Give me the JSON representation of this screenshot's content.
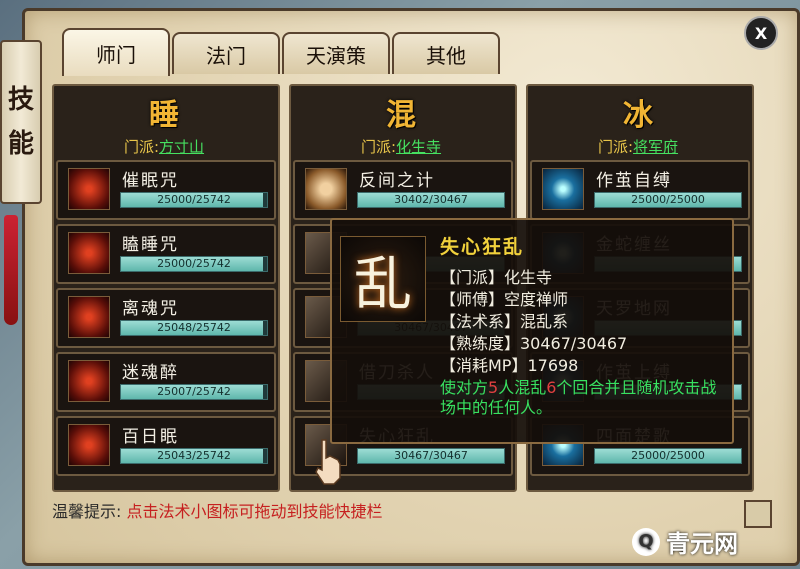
{
  "window": {
    "side_title": [
      "技",
      "能"
    ],
    "close_label": "X"
  },
  "tabs": [
    "师门",
    "法门",
    "天演策",
    "其他"
  ],
  "schools": [
    {
      "element": "睡",
      "sect_label": "门派:",
      "sect": "方寸山",
      "skills": [
        {
          "name": "催眠咒",
          "progress": "25000/25742",
          "fraction": 0.971,
          "icon": "red"
        },
        {
          "name": "瞌睡咒",
          "progress": "25000/25742",
          "fraction": 0.971,
          "icon": "red"
        },
        {
          "name": "离魂咒",
          "progress": "25048/25742",
          "fraction": 0.973,
          "icon": "red"
        },
        {
          "name": "迷魂醉",
          "progress": "25007/25742",
          "fraction": 0.971,
          "icon": "red"
        },
        {
          "name": "百日眠",
          "progress": "25043/25742",
          "fraction": 0.973,
          "icon": "red"
        }
      ]
    },
    {
      "element": "混",
      "sect_label": "门派:",
      "sect": "化生寺",
      "skills": [
        {
          "name": "反间之计",
          "progress": "30402/30467",
          "fraction": 0.998,
          "icon": "face"
        },
        {
          "name": "",
          "progress": "",
          "fraction": 0.998,
          "icon": "dark"
        },
        {
          "name": "",
          "progress": "30467/30467",
          "fraction": 1.0,
          "icon": "dark"
        },
        {
          "name": "借刀杀人",
          "progress": "",
          "fraction": 1.0,
          "icon": "dark"
        },
        {
          "name": "失心狂乱",
          "progress": "30467/30467",
          "fraction": 1.0,
          "icon": "dark"
        }
      ]
    },
    {
      "element": "冰",
      "sect_label": "门派:",
      "sect": "将军府",
      "skills": [
        {
          "name": "作茧自缚",
          "progress": "25000/25000",
          "fraction": 1.0,
          "icon": "blue"
        },
        {
          "name": "金蛇缠丝",
          "progress": "",
          "fraction": 1.0,
          "icon": "blue"
        },
        {
          "name": "天罗地网",
          "progress": "",
          "fraction": 1.0,
          "icon": "blue"
        },
        {
          "name": "作茧上缚",
          "progress": "",
          "fraction": 1.0,
          "icon": "blue"
        },
        {
          "name": "四面楚歌",
          "progress": "25000/25000",
          "fraction": 1.0,
          "icon": "blue"
        }
      ]
    }
  ],
  "tooltip": {
    "glyph": "乱",
    "title": "失心狂乱",
    "lines": [
      "【门派】化生寺",
      "【师傅】空度禅师",
      "【法术系】混乱系",
      "【熟练度】30467/30467",
      "【消耗MP】17698"
    ],
    "desc_pre": "使对方",
    "desc_n1": "5",
    "desc_mid": "人混乱",
    "desc_n2": "6",
    "desc_post": "个回合并且随机攻击战场中的任何人。"
  },
  "hint": {
    "label": "温馨提示:",
    "text": "点击法术小图标可拖动到技能快捷栏"
  },
  "watermark": {
    "icon": "Q",
    "text": "青元网"
  }
}
